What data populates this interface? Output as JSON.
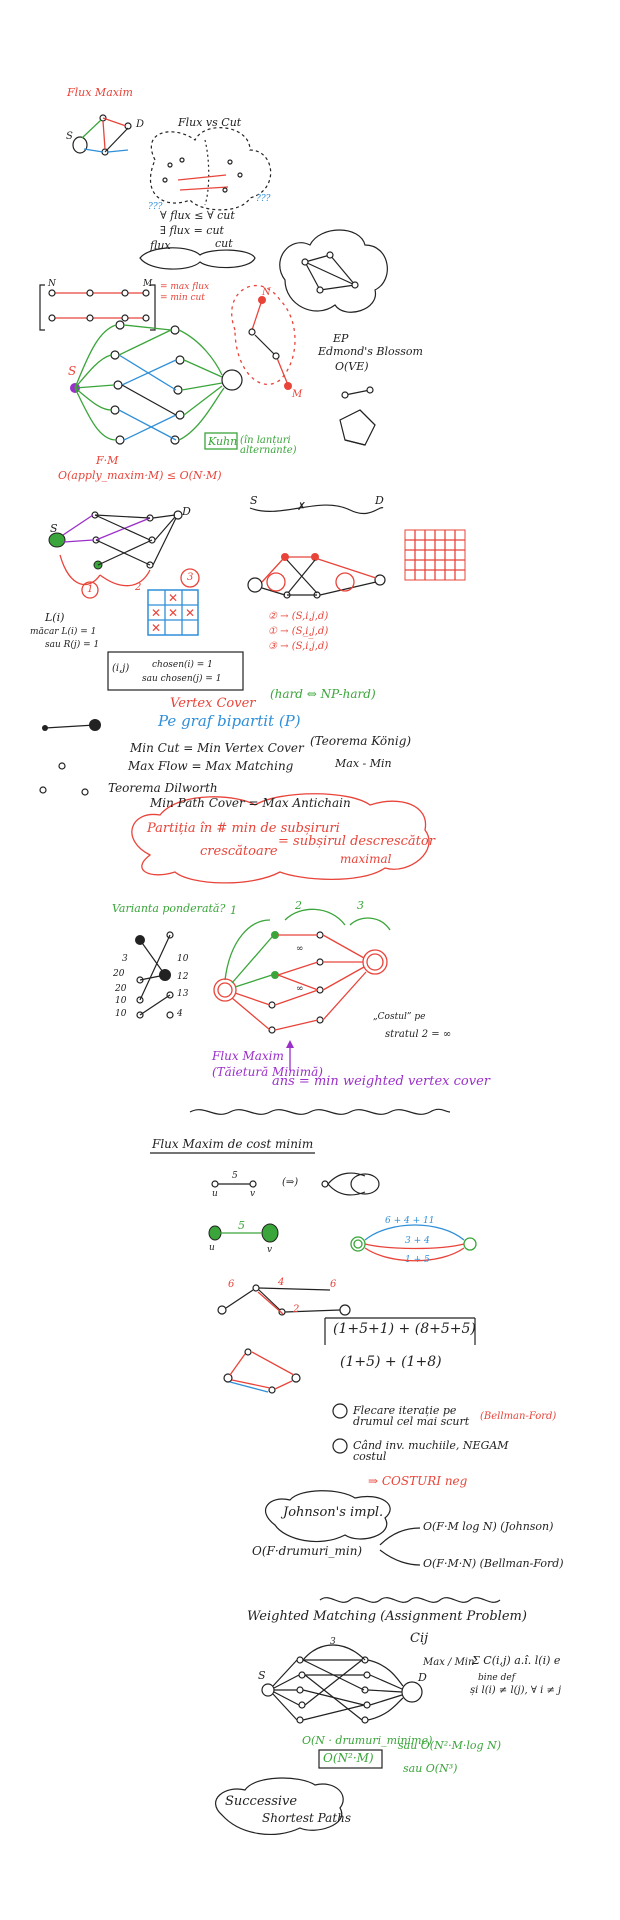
{
  "section1": {
    "title": "Flux Maxim",
    "flux_vs_cut": "Flux vs Cut",
    "node_s": "S",
    "node_d": "D",
    "marks_left": "???",
    "marks_right": "???",
    "line1": "∀ flux ≤ ∀ cut",
    "line2": "∃ flux = cut",
    "flux_word": "flux",
    "cut_word": "cut"
  },
  "section2": {
    "node_n": "N",
    "node_m": "M",
    "legend1": "= max flux",
    "legend2": "= min cut",
    "node_s": "S",
    "node_n_red": "N",
    "node_m_red": "M",
    "ep": "EP",
    "edmonds": "Edmond's Blossom",
    "edmonds_complexity": "O(VE)",
    "fm": "F·M",
    "complexity": "O(apply_maxim·M) ≤ O(N·M)",
    "kuhn": "Kuhn",
    "kuhn_note": "(în lanțuri alternante)"
  },
  "section3": {
    "node_s": "S",
    "node_d": "D",
    "node_s2": "S",
    "node_d2": "D",
    "l_of_i": "L(i)",
    "n_label": "n",
    "macar_l": "măcar L(i) = 1",
    "sau_r": "sau R(j) = 1",
    "circle1": "1",
    "circle2": "2",
    "circle3": "3",
    "pair_ij": "(i,j)",
    "chosen1": "chosen(i) = 1",
    "chosen2": "sau chosen(j) = 1",
    "path1": "② → (S,i,j,d)",
    "path2": "① → (S,i̲,j̲,d)",
    "path3": "③ → (S,i,j,d)"
  },
  "section4": {
    "vertex_cover": "Vertex Cover",
    "hard_note": "(hard ⇔ NP-hard)",
    "bipartite": "Pe graf bipartit  (P)",
    "min_cut": "Min Cut = Min Vertex Cover",
    "konig": "(Teorema König)",
    "max_flow": "Max Flow = Max Matching",
    "max_min": "Max - Min",
    "dilworth": "Teorema Dilworth",
    "path_cover": "Min Path Cover = Max Antichain",
    "partitia": "Partiția în # min de subșiruri",
    "crescatoare": "crescătoare",
    "subsir": "= subșirul descrescător",
    "maximal": "maximal"
  },
  "section5": {
    "varianta": "Varianta ponderată?",
    "weights_left": [
      "3",
      "20",
      "20",
      "10",
      "10"
    ],
    "weights_right": [
      "10",
      "12",
      "13",
      "4"
    ],
    "label_1": "1",
    "label_2": "2",
    "label_3": "3",
    "infinity": "∞",
    "costul": "„Costul” pe",
    "stratul": "stratul 2 = ∞",
    "flux_maxim": "Flux Maxim",
    "taietura": "(Tăietură Minimă)",
    "ans": "ans = min weighted vertex cover"
  },
  "section6": {
    "title": "Flux Maxim de cost minim",
    "u": "u",
    "v": "v",
    "cost5": "5",
    "equiv": "(⇒)",
    "path_top": "6 + 4 + 11",
    "path_mid": "3 + 4",
    "path_bot": "1 + 5",
    "red6a": "6",
    "red4": "4",
    "red6b": "6",
    "red2": "2",
    "brackets1": "(1+5+1) + (8+5+5)",
    "brackets2": "(1+5) + (1+8)",
    "step1": "Flecare iterație pe drumul cel mai scurt",
    "bellman": "(Bellman-Ford)",
    "step2": "Când inv. muchiile, NEGAM costul",
    "negative": "⇒ COSTURI neg",
    "johnson": "Johnson's impl.",
    "o_drumuri": "O(F·drumuri_min)",
    "o_johnson": "O(F·M log N)  (Johnson)",
    "o_bellman": "O(F·M·N)  (Bellman-Ford)"
  },
  "section7": {
    "title": "Weighted Matching  (Assignment Problem)",
    "cij": "Cij",
    "maxmin": "Max / Min",
    "sum": "Σ C(i,j) a.î. l(i) e",
    "bine_def": "bine def",
    "si": "și l(i) ≠ l(j), ∀ i ≠ j",
    "node_s": "S",
    "node_d": "D",
    "top_w": "3",
    "complexity": "O(N · drumuri_minime)",
    "boxed": "O(N²·M)",
    "sau1": "sau O(N²·M·log N)",
    "sau2": "sau O(N³)",
    "ssp1": "Successive",
    "ssp2": "Shortest Paths"
  }
}
